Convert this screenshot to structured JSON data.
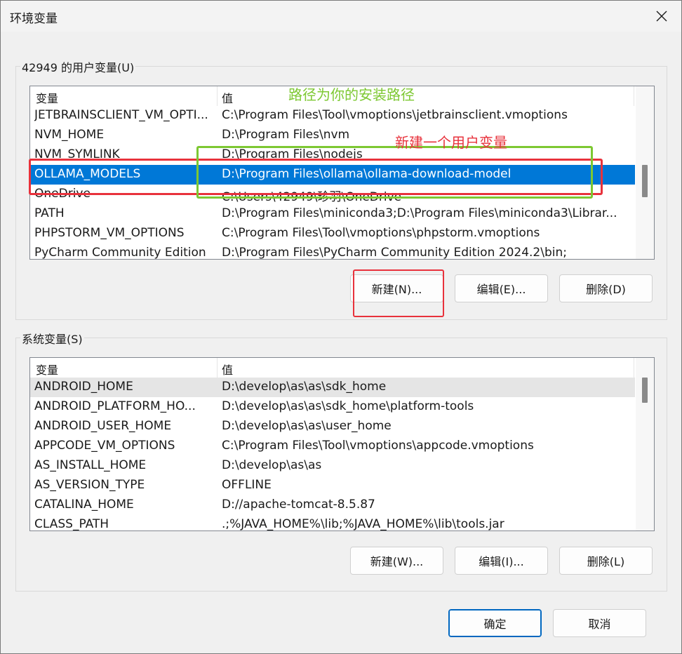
{
  "window": {
    "title": "环境变量",
    "close_icon": "close-icon"
  },
  "user_vars": {
    "group_label": "42949 的用户变量(U)",
    "col_name": "变量",
    "col_value": "值",
    "rows": [
      {
        "name": "JETBRAINSCLIENT_VM_OPTI...",
        "value": "C:\\Program Files\\Tool\\vmoptions\\jetbrainsclient.vmoptions"
      },
      {
        "name": "NVM_HOME",
        "value": "D:\\Program Files\\nvm"
      },
      {
        "name": "NVM_SYMLINK",
        "value": "D:\\Program Files\\nodejs"
      },
      {
        "name": "OLLAMA_MODELS",
        "value": "D:\\Program Files\\ollama\\ollama-download-model",
        "selected": true
      },
      {
        "name": "OneDrive",
        "value": "C:\\Users\\42949\\珍羽\\OneDrive"
      },
      {
        "name": "PATH",
        "value": "D:\\Program Files\\miniconda3;D:\\Program Files\\miniconda3\\Librar..."
      },
      {
        "name": "PHPSTORM_VM_OPTIONS",
        "value": "C:\\Program Files\\Tool\\vmoptions\\phpstorm.vmoptions"
      },
      {
        "name": "PyCharm Community Edition",
        "value": "D:\\Program Files\\PyCharm Community Edition 2024.2\\bin;"
      }
    ],
    "buttons": {
      "new": "新建(N)...",
      "edit": "编辑(E)...",
      "delete": "删除(D)"
    }
  },
  "system_vars": {
    "group_label": "系统变量(S)",
    "col_name": "变量",
    "col_value": "值",
    "rows": [
      {
        "name": "ANDROID_HOME",
        "value": "D:\\develop\\as\\as\\sdk_home",
        "hover": true
      },
      {
        "name": "ANDROID_PLATFORM_HO...",
        "value": "D:\\develop\\as\\as\\sdk_home\\platform-tools"
      },
      {
        "name": "ANDROID_USER_HOME",
        "value": "D:\\develop\\as\\as\\user_home"
      },
      {
        "name": "APPCODE_VM_OPTIONS",
        "value": "C:\\Program Files\\Tool\\vmoptions\\appcode.vmoptions"
      },
      {
        "name": "AS_INSTALL_HOME",
        "value": "D:\\develop\\as\\as"
      },
      {
        "name": "AS_VERSION_TYPE",
        "value": "OFFLINE"
      },
      {
        "name": "CATALINA_HOME",
        "value": "D://apache-tomcat-8.5.87"
      },
      {
        "name": "CLASS_PATH",
        "value": ".;%JAVA_HOME%\\lib;%JAVA_HOME%\\lib\\tools.jar"
      }
    ],
    "buttons": {
      "new": "新建(W)...",
      "edit": "编辑(I)...",
      "delete": "删除(L)"
    }
  },
  "footer": {
    "ok": "确定",
    "cancel": "取消"
  },
  "annotations": {
    "green_note": "路径为你的安装路径",
    "red_note": "新建一个用户变量",
    "green_color": "#7dc832",
    "red_color": "#e8323c"
  },
  "colors": {
    "selection": "#0078d7",
    "hover_row": "#e5e5e5"
  }
}
